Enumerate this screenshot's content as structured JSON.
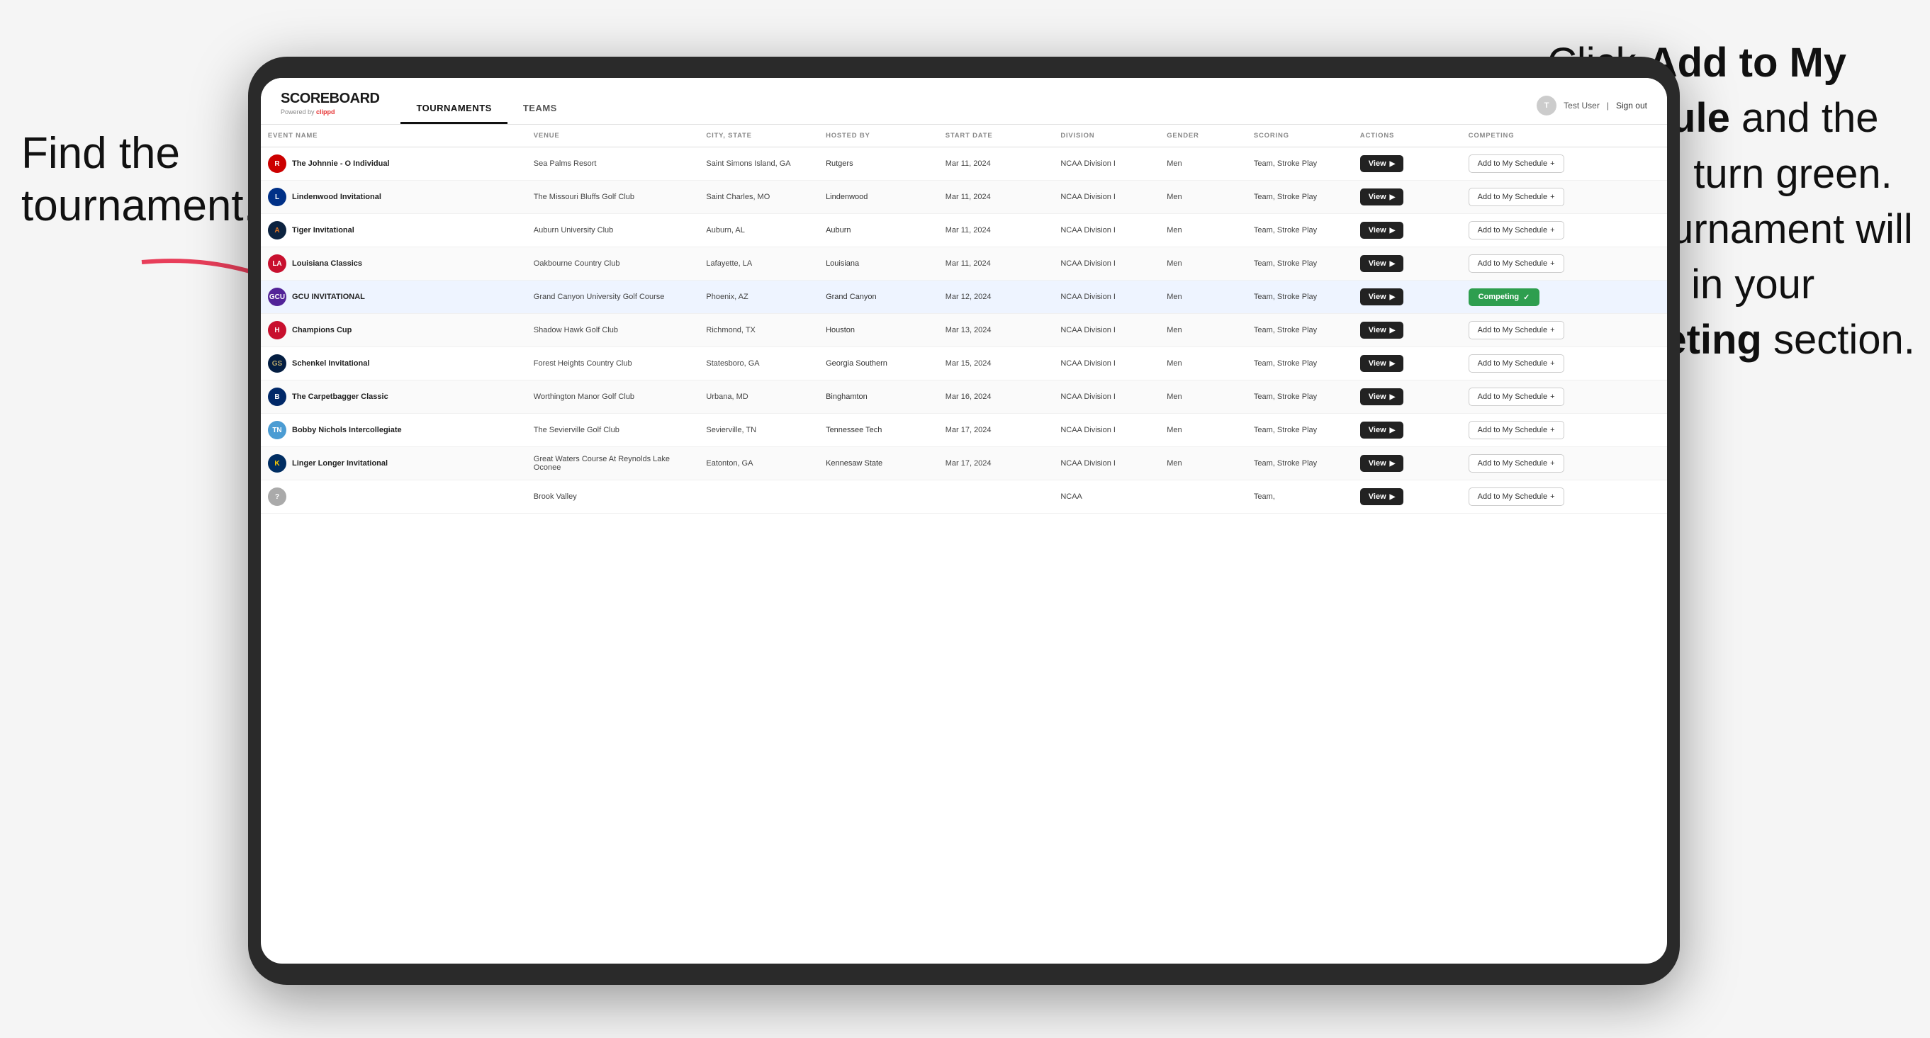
{
  "page": {
    "background": "#f5f5f5"
  },
  "annotation_left": {
    "line1": "Find the",
    "line2": "tournament."
  },
  "annotation_right": {
    "text_before": "Click ",
    "bold1": "Add to My Schedule",
    "text_mid": " and the box will turn green. This tournament will now be in your ",
    "bold2": "Competing",
    "text_end": " section."
  },
  "navbar": {
    "logo": "SCOREBOARD",
    "powered_by": "Powered by",
    "clippd": "clippd",
    "tabs": [
      "TOURNAMENTS",
      "TEAMS"
    ],
    "active_tab": "TOURNAMENTS",
    "user": "Test User",
    "sign_out": "Sign out"
  },
  "table": {
    "headers": [
      "EVENT NAME",
      "VENUE",
      "CITY, STATE",
      "HOSTED BY",
      "START DATE",
      "DIVISION",
      "GENDER",
      "SCORING",
      "ACTIONS",
      "COMPETING"
    ],
    "rows": [
      {
        "id": 1,
        "logo_text": "R",
        "logo_class": "logo-r",
        "event_name": "The Johnnie - O Individual",
        "venue": "Sea Palms Resort",
        "city_state": "Saint Simons Island, GA",
        "hosted_by": "Rutgers",
        "start_date": "Mar 11, 2024",
        "division": "NCAA Division I",
        "gender": "Men",
        "scoring": "Team, Stroke Play",
        "competing": "add"
      },
      {
        "id": 2,
        "logo_text": "L",
        "logo_class": "logo-l",
        "event_name": "Lindenwood Invitational",
        "venue": "The Missouri Bluffs Golf Club",
        "city_state": "Saint Charles, MO",
        "hosted_by": "Lindenwood",
        "start_date": "Mar 11, 2024",
        "division": "NCAA Division I",
        "gender": "Men",
        "scoring": "Team, Stroke Play",
        "competing": "add"
      },
      {
        "id": 3,
        "logo_text": "A",
        "logo_class": "logo-a",
        "event_name": "Tiger Invitational",
        "venue": "Auburn University Club",
        "city_state": "Auburn, AL",
        "hosted_by": "Auburn",
        "start_date": "Mar 11, 2024",
        "division": "NCAA Division I",
        "gender": "Men",
        "scoring": "Team, Stroke Play",
        "competing": "add"
      },
      {
        "id": 4,
        "logo_text": "LA",
        "logo_class": "logo-la",
        "event_name": "Louisiana Classics",
        "venue": "Oakbourne Country Club",
        "city_state": "Lafayette, LA",
        "hosted_by": "Louisiana",
        "start_date": "Mar 11, 2024",
        "division": "NCAA Division I",
        "gender": "Men",
        "scoring": "Team, Stroke Play",
        "competing": "add"
      },
      {
        "id": 5,
        "logo_text": "GCU",
        "logo_class": "logo-gcu",
        "event_name": "GCU INVITATIONAL",
        "venue": "Grand Canyon University Golf Course",
        "city_state": "Phoenix, AZ",
        "hosted_by": "Grand Canyon",
        "start_date": "Mar 12, 2024",
        "division": "NCAA Division I",
        "gender": "Men",
        "scoring": "Team, Stroke Play",
        "competing": "competing",
        "highlighted": true
      },
      {
        "id": 6,
        "logo_text": "H",
        "logo_class": "logo-h",
        "event_name": "Champions Cup",
        "venue": "Shadow Hawk Golf Club",
        "city_state": "Richmond, TX",
        "hosted_by": "Houston",
        "start_date": "Mar 13, 2024",
        "division": "NCAA Division I",
        "gender": "Men",
        "scoring": "Team, Stroke Play",
        "competing": "add"
      },
      {
        "id": 7,
        "logo_text": "GS",
        "logo_class": "logo-gs",
        "event_name": "Schenkel Invitational",
        "venue": "Forest Heights Country Club",
        "city_state": "Statesboro, GA",
        "hosted_by": "Georgia Southern",
        "start_date": "Mar 15, 2024",
        "division": "NCAA Division I",
        "gender": "Men",
        "scoring": "Team, Stroke Play",
        "competing": "add"
      },
      {
        "id": 8,
        "logo_text": "B",
        "logo_class": "logo-b",
        "event_name": "The Carpetbagger Classic",
        "venue": "Worthington Manor Golf Club",
        "city_state": "Urbana, MD",
        "hosted_by": "Binghamton",
        "start_date": "Mar 16, 2024",
        "division": "NCAA Division I",
        "gender": "Men",
        "scoring": "Team, Stroke Play",
        "competing": "add"
      },
      {
        "id": 9,
        "logo_text": "TN",
        "logo_class": "logo-tn",
        "event_name": "Bobby Nichols Intercollegiate",
        "venue": "The Sevierville Golf Club",
        "city_state": "Sevierville, TN",
        "hosted_by": "Tennessee Tech",
        "start_date": "Mar 17, 2024",
        "division": "NCAA Division I",
        "gender": "Men",
        "scoring": "Team, Stroke Play",
        "competing": "add"
      },
      {
        "id": 10,
        "logo_text": "K",
        "logo_class": "logo-ken",
        "event_name": "Linger Longer Invitational",
        "venue": "Great Waters Course At Reynolds Lake Oconee",
        "city_state": "Eatonton, GA",
        "hosted_by": "Kennesaw State",
        "start_date": "Mar 17, 2024",
        "division": "NCAA Division I",
        "gender": "Men",
        "scoring": "Team, Stroke Play",
        "competing": "add"
      },
      {
        "id": 11,
        "logo_text": "?",
        "logo_class": "logo-gen",
        "event_name": "",
        "venue": "Brook Valley",
        "city_state": "",
        "hosted_by": "",
        "start_date": "",
        "division": "NCAA",
        "gender": "",
        "scoring": "Team,",
        "competing": "add_partial"
      }
    ]
  },
  "buttons": {
    "view_label": "View",
    "add_label": "Add to My Schedule",
    "add_plus": "+",
    "competing_label": "Competing",
    "competing_check": "✓"
  }
}
